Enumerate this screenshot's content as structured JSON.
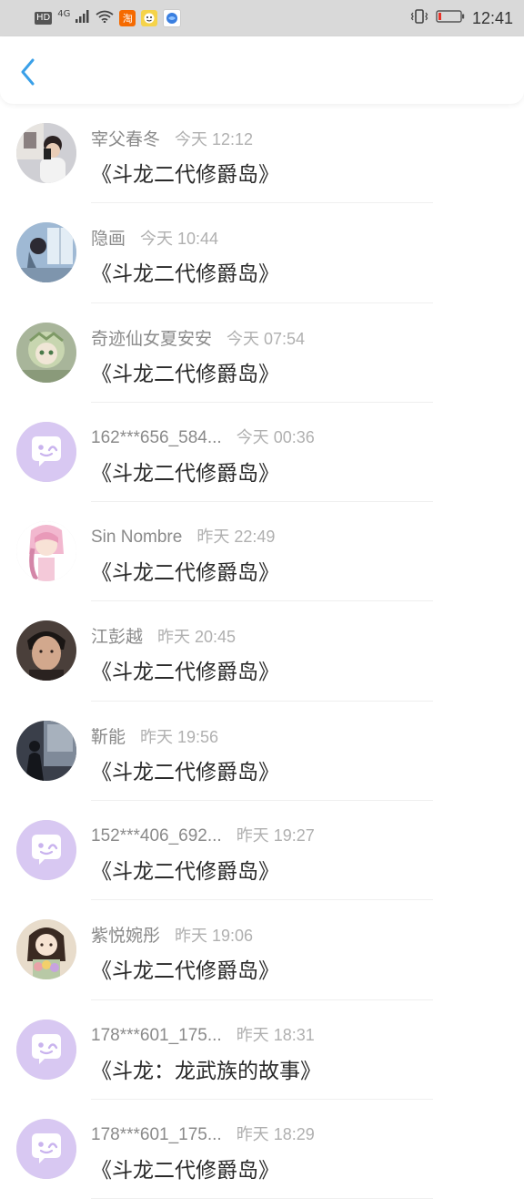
{
  "status_bar": {
    "time": "12:41",
    "badge_hd": "HD",
    "network": "4G",
    "app_taobao": "淘"
  },
  "header": {
    "back_icon": "chevron-left-icon"
  },
  "colors": {
    "accent": "#3aa0e8",
    "placeholder_avatar_bg": "#d8c8f2",
    "name_gray": "#8a8a8a",
    "time_gray": "#b0b0b0"
  },
  "items": [
    {
      "name": "宰父春冬",
      "time": "今天 12:12",
      "book": "《斗龙二代修爵岛》",
      "avatar": "photo"
    },
    {
      "name": "隐画",
      "time": "今天 10:44",
      "book": "《斗龙二代修爵岛》",
      "avatar": "photo"
    },
    {
      "name": "奇迹仙女夏安安",
      "time": "今天 07:54",
      "book": "《斗龙二代修爵岛》",
      "avatar": "photo"
    },
    {
      "name": "162***656_584...",
      "time": "今天 00:36",
      "book": "《斗龙二代修爵岛》",
      "avatar": "placeholder"
    },
    {
      "name": "Sin Nombre",
      "time": "昨天 22:49",
      "book": "《斗龙二代修爵岛》",
      "avatar": "photo"
    },
    {
      "name": "江彭越",
      "time": "昨天 20:45",
      "book": "《斗龙二代修爵岛》",
      "avatar": "photo"
    },
    {
      "name": "靳能",
      "time": "昨天 19:56",
      "book": "《斗龙二代修爵岛》",
      "avatar": "photo"
    },
    {
      "name": "152***406_692...",
      "time": "昨天 19:27",
      "book": "《斗龙二代修爵岛》",
      "avatar": "placeholder"
    },
    {
      "name": "紫悦婉彤",
      "time": "昨天 19:06",
      "book": "《斗龙二代修爵岛》",
      "avatar": "photo"
    },
    {
      "name": "178***601_175...",
      "time": "昨天 18:31",
      "book": "《斗龙：龙武族的故事》",
      "avatar": "placeholder"
    },
    {
      "name": "178***601_175...",
      "time": "昨天 18:29",
      "book": "《斗龙二代修爵岛》",
      "avatar": "placeholder"
    }
  ]
}
